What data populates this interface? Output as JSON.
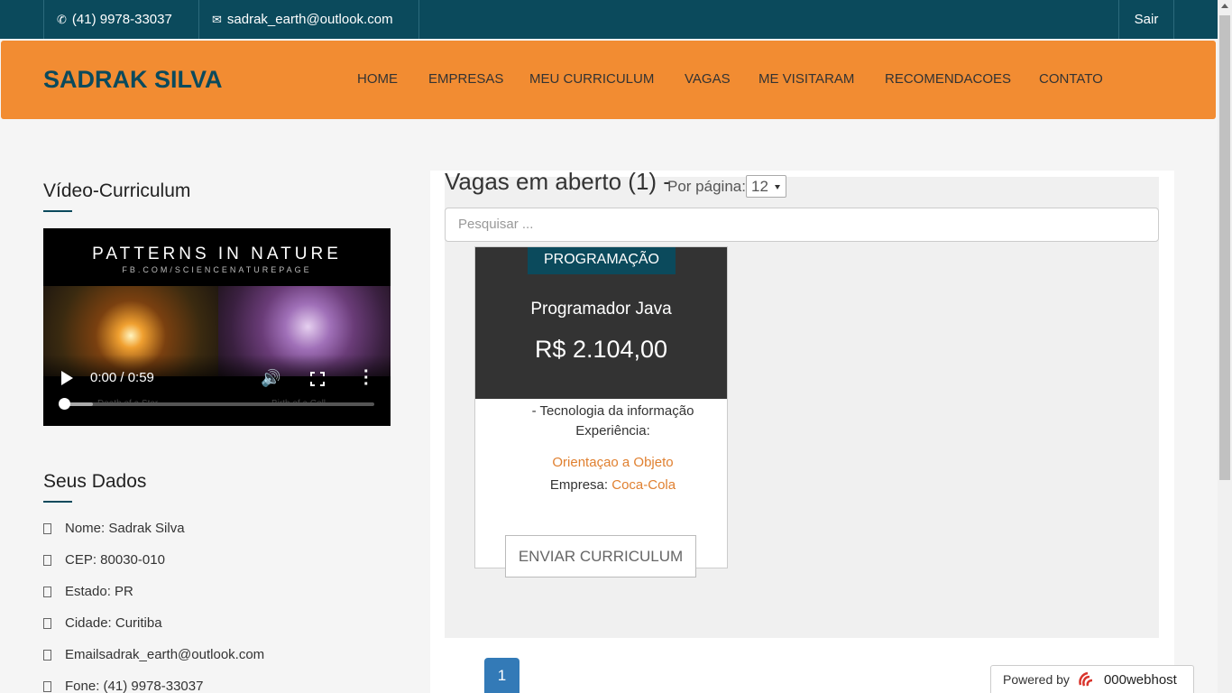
{
  "topbar": {
    "phone": "(41) 9978-33037",
    "email": "sadrak_earth@outlook.com",
    "logout": "Sair"
  },
  "navbar": {
    "brand": "SADRAK SILVA",
    "items": [
      "HOME",
      "EMPRESAS",
      "MEU CURRICULUM",
      "VAGAS",
      "ME VISITARAM",
      "RECOMENDACOES",
      "CONTATO"
    ]
  },
  "sidebar": {
    "video_title": "Vídeo-Curriculum",
    "video": {
      "title": "PATTERNS IN NATURE",
      "subtitle": "FB.COM/SCIENCENATUREPAGE",
      "time": "0:00 / 0:59",
      "caption_left": "Death of a Star",
      "caption_right": "Birth of a Cell",
      "progress": 0
    },
    "data_title": "Seus Dados",
    "data": [
      "Nome: Sadrak Silva",
      "CEP: 80030-010",
      "Estado: PR",
      "Cidade: Curitiba",
      "Emailsadrak_earth@outlook.com",
      "Fone: (41) 9978-33037"
    ]
  },
  "main": {
    "heading": "Vagas em aberto (1) -",
    "per_page_label": "Por página:",
    "per_page_value": "12",
    "search_placeholder": "Pesquisar ...",
    "job": {
      "category": "PROGRAMAÇÃO",
      "title": "Programador Java",
      "salary": "R$ 2.104,00",
      "area": "- Tecnologia da informação",
      "experience_label": "Experiência:",
      "skill": "Orientaçao a Objeto",
      "company_label": "Empresa:",
      "company": "Coca-Cola",
      "button": "ENVIAR CURRICULUM"
    },
    "pagination": [
      "1"
    ]
  },
  "footer": {
    "powered_label": "Powered by",
    "powered_brand": "000webhost"
  },
  "colors": {
    "topbar": "#0b4a5c",
    "navbar": "#f28c32",
    "accent_link": "#e08030",
    "pagination": "#337ab7"
  }
}
